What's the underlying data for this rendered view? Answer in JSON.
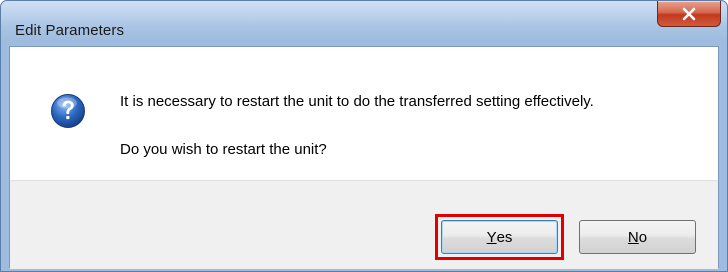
{
  "window": {
    "title": "Edit Parameters"
  },
  "dialog": {
    "icon": "question-icon",
    "message_line1": "It is necessary to restart the unit to do the transferred setting effectively.",
    "message_line2": "Do you wish to restart the unit?"
  },
  "buttons": {
    "yes": {
      "mnemonic": "Y",
      "rest": "es"
    },
    "no": {
      "mnemonic": "N",
      "rest": "o"
    }
  },
  "colors": {
    "highlight": "#e00000",
    "close_button": "#c1391f",
    "titlebar": "#b9cfea",
    "footer": "#f0f0f0"
  }
}
